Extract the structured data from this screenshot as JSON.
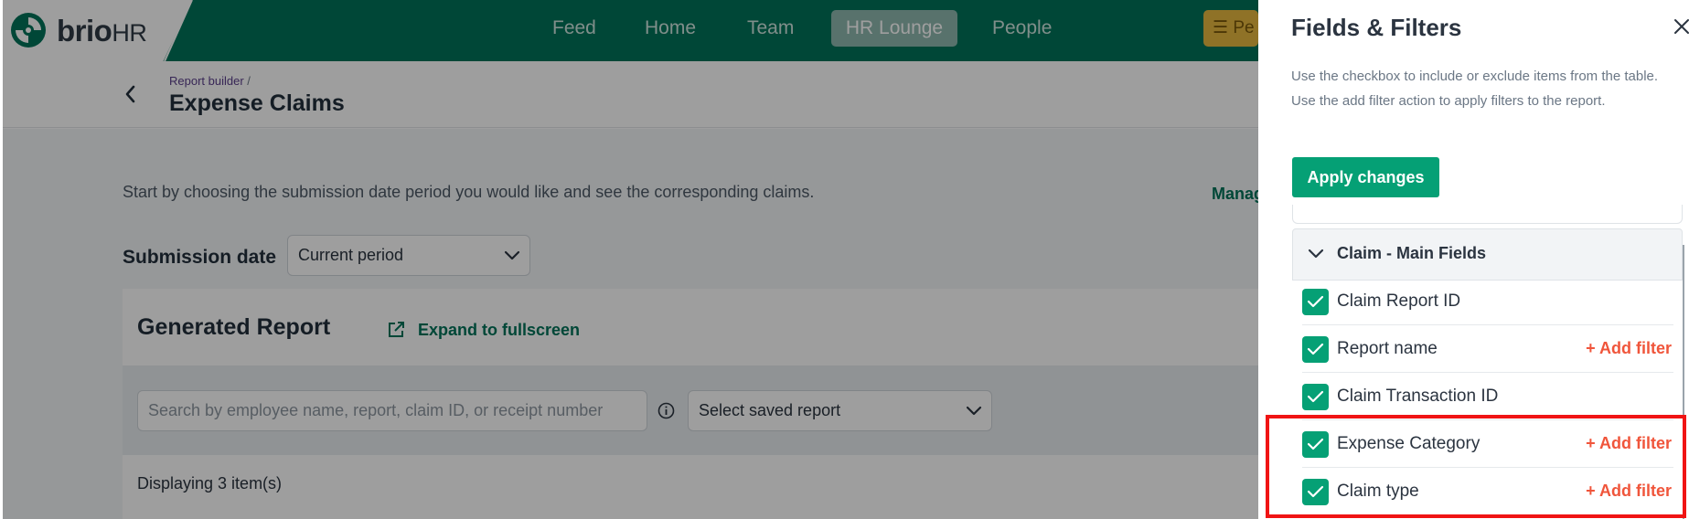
{
  "brand": {
    "name": "brio",
    "suffix": "HR"
  },
  "nav": {
    "items": [
      "Feed",
      "Home",
      "Team",
      "HR Lounge",
      "People"
    ],
    "active": "HR Lounge",
    "pe_button": "Pe"
  },
  "breadcrumb": {
    "parent": "Report builder",
    "separator": "/"
  },
  "page_title": "Expense Claims",
  "intro_text": "Start by choosing the submission date period you would like and see the corresponding claims.",
  "manage_link": "Manag",
  "submission": {
    "label": "Submission date",
    "value": "Current period"
  },
  "report": {
    "title": "Generated Report",
    "expand_label": "Expand to fullscreen",
    "search_placeholder": "Search by employee name, report, claim ID, or receipt number",
    "saved_report_placeholder": "Select saved report",
    "count_text": "Displaying 3 item(s)"
  },
  "panel": {
    "title": "Fields & Filters",
    "description": "Use the checkbox to include or exclude items from the table. Use the add filter action to apply filters to the report.",
    "apply_label": "Apply changes",
    "group_label": "Claim - Main Fields",
    "add_filter_label": "+ Add filter",
    "fields": [
      {
        "label": "Claim Report ID",
        "checked": true,
        "has_filter": false
      },
      {
        "label": "Report name",
        "checked": true,
        "has_filter": true
      },
      {
        "label": "Claim Transaction ID",
        "checked": true,
        "has_filter": false
      },
      {
        "label": "Expense Category",
        "checked": true,
        "has_filter": true
      },
      {
        "label": "Claim type",
        "checked": true,
        "has_filter": true
      }
    ]
  },
  "colors": {
    "brand_green": "#00735a",
    "checkbox_green": "#05a075",
    "add_filter_red": "#f0553b",
    "highlight_red": "#f01414"
  }
}
